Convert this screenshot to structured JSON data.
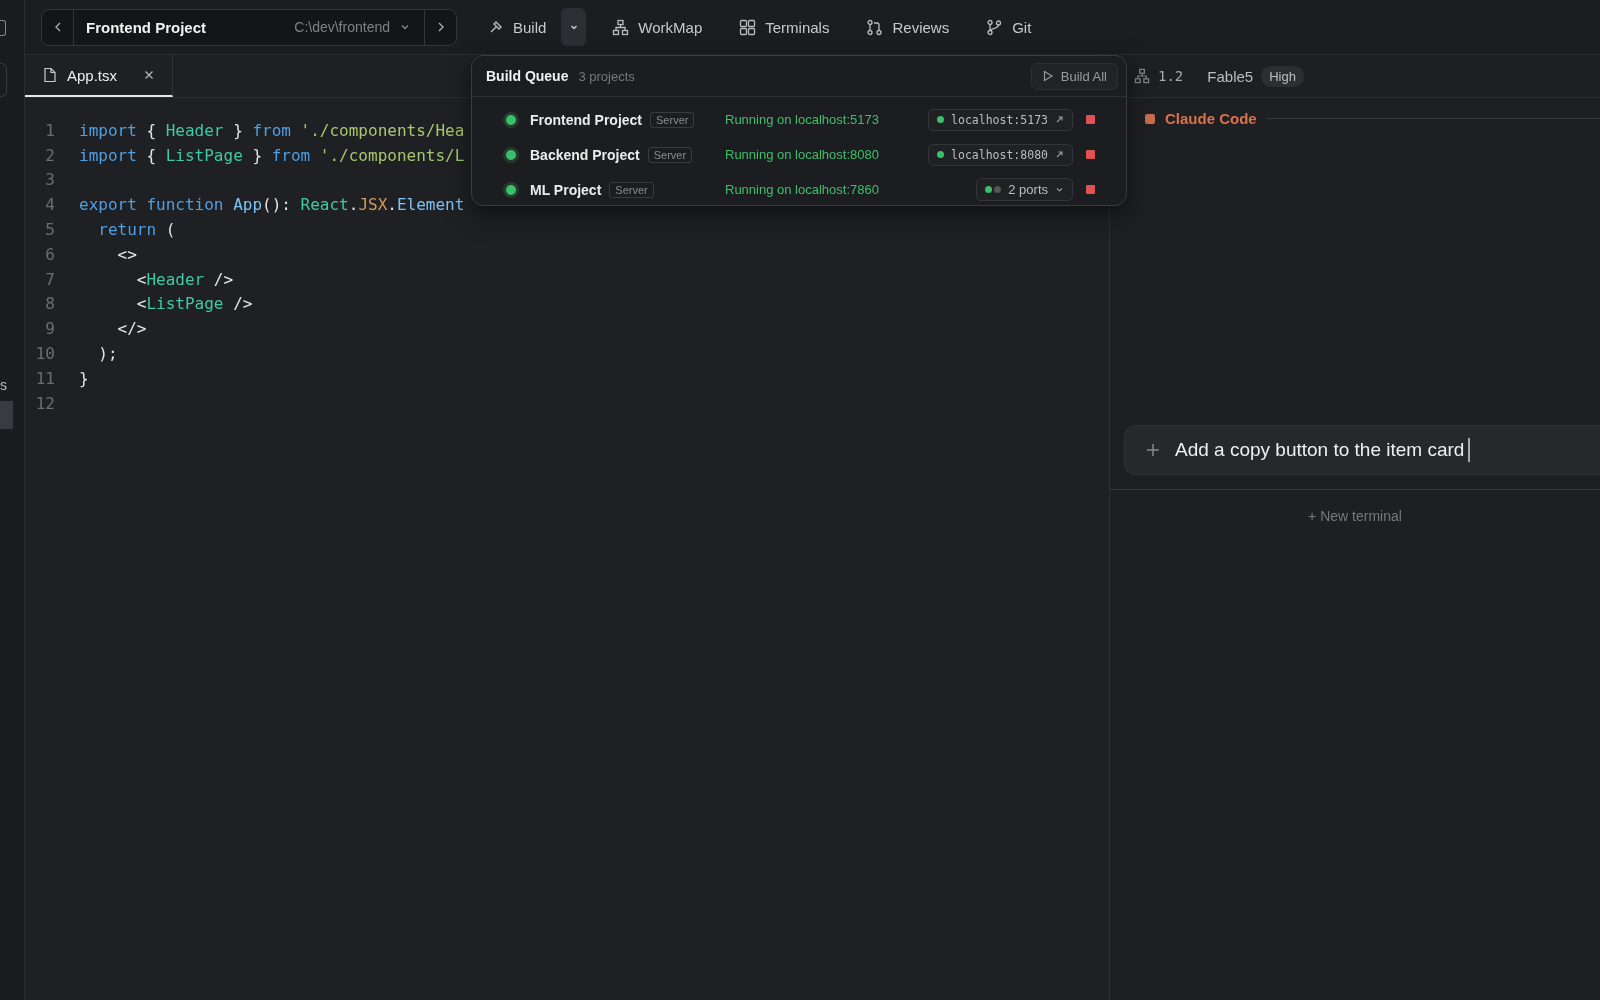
{
  "left_rail": {
    "fragment": "s"
  },
  "project_selector": {
    "name": "Frontend Project",
    "path": "C:\\dev\\frontend"
  },
  "toolbar": {
    "build": {
      "label": "Build",
      "expanded": true
    },
    "items": [
      {
        "label": "WorkMap",
        "kind": "hierarchy"
      },
      {
        "label": "Terminals",
        "kind": "grid"
      },
      {
        "label": "Reviews",
        "kind": "pull-request"
      },
      {
        "label": "Git",
        "kind": "branch"
      }
    ]
  },
  "tabs": [
    {
      "label": "App.tsx",
      "selected": true
    }
  ],
  "editor": {
    "lines": [
      {
        "number": "1",
        "tokens": [
          {
            "text": "import",
            "kind": "keyword"
          },
          {
            "text": " { ",
            "kind": "plain"
          },
          {
            "text": "Header",
            "kind": "name"
          },
          {
            "text": " } ",
            "kind": "plain"
          },
          {
            "text": "from",
            "kind": "keyword"
          },
          {
            "text": " './components/Hea",
            "kind": "string"
          }
        ]
      },
      {
        "number": "2",
        "tokens": [
          {
            "text": "import",
            "kind": "keyword"
          },
          {
            "text": " { ",
            "kind": "plain"
          },
          {
            "text": "ListPage",
            "kind": "name"
          },
          {
            "text": " } ",
            "kind": "plain"
          },
          {
            "text": "from",
            "kind": "keyword"
          },
          {
            "text": " './components/L",
            "kind": "string"
          }
        ]
      },
      {
        "number": "3"
      },
      {
        "number": "4",
        "tokens": [
          {
            "text": "export function ",
            "kind": "keyword"
          },
          {
            "text": "App",
            "kind": "function"
          },
          {
            "text": "(): ",
            "kind": "plain"
          },
          {
            "text": "React",
            "kind": "name"
          },
          {
            "text": ".",
            "kind": "plain"
          },
          {
            "text": "JSX",
            "kind": "accent"
          },
          {
            "text": ".",
            "kind": "plain"
          },
          {
            "text": "Element",
            "kind": "function"
          }
        ]
      },
      {
        "number": "5",
        "tokens": [
          {
            "text": "  return",
            "kind": "keyword"
          },
          {
            "text": " (",
            "kind": "plain"
          }
        ]
      },
      {
        "number": "6",
        "tokens": [
          {
            "text": "    <>",
            "kind": "plain"
          }
        ]
      },
      {
        "number": "7",
        "tokens": [
          {
            "text": "      <",
            "kind": "plain"
          },
          {
            "text": "Header",
            "kind": "name"
          },
          {
            "text": " />",
            "kind": "plain"
          }
        ]
      },
      {
        "number": "8",
        "tokens": [
          {
            "text": "      <",
            "kind": "plain"
          },
          {
            "text": "ListPage",
            "kind": "name"
          },
          {
            "text": " />",
            "kind": "plain"
          }
        ]
      },
      {
        "number": "9",
        "tokens": [
          {
            "text": "    </>",
            "kind": "plain"
          }
        ]
      },
      {
        "number": "10",
        "tokens": [
          {
            "text": "  );",
            "kind": "plain"
          }
        ]
      },
      {
        "number": "11",
        "tokens": [
          {
            "text": "}",
            "kind": "plain"
          }
        ]
      },
      {
        "number": "12"
      }
    ]
  },
  "session": {
    "version": "1.2",
    "model": "Fable5",
    "effort": "High"
  },
  "agent": {
    "name": "Claude Code"
  },
  "prompt": {
    "value": "Add a copy button to the item card"
  },
  "new_terminal": "+ New terminal",
  "build_queue": {
    "title": "Build Queue",
    "count": "3 projects",
    "build_all": "Build All",
    "projects": [
      {
        "name": "Frontend Project",
        "tag": "Server",
        "running": true,
        "status": "Running on localhost:5173",
        "port": {
          "kind": "single",
          "label": "localhost:5173",
          "dots": [
            {
              "on": true
            }
          ]
        }
      },
      {
        "name": "Backend Project",
        "tag": "Server",
        "running": true,
        "status": "Running on localhost:8080",
        "port": {
          "kind": "single",
          "label": "localhost:8080",
          "dots": [
            {
              "on": true
            }
          ]
        }
      },
      {
        "name": "ML Project",
        "tag": "Server",
        "running": true,
        "status": "Running on localhost:7860",
        "port": {
          "kind": "multi",
          "label": "2 ports",
          "dots": [
            {
              "on": true
            },
            {
              "on": false
            }
          ]
        }
      }
    ]
  }
}
